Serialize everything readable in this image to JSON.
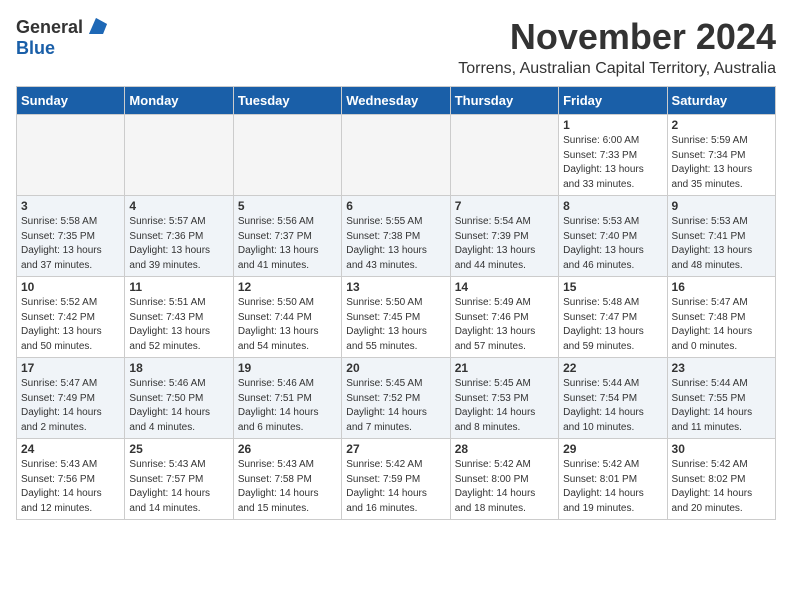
{
  "header": {
    "logo_general": "General",
    "logo_blue": "Blue",
    "month_year": "November 2024",
    "location": "Torrens, Australian Capital Territory, Australia"
  },
  "calendar": {
    "days_of_week": [
      "Sunday",
      "Monday",
      "Tuesday",
      "Wednesday",
      "Thursday",
      "Friday",
      "Saturday"
    ],
    "weeks": [
      [
        {
          "day": "",
          "info": ""
        },
        {
          "day": "",
          "info": ""
        },
        {
          "day": "",
          "info": ""
        },
        {
          "day": "",
          "info": ""
        },
        {
          "day": "",
          "info": ""
        },
        {
          "day": "1",
          "info": "Sunrise: 6:00 AM\nSunset: 7:33 PM\nDaylight: 13 hours\nand 33 minutes."
        },
        {
          "day": "2",
          "info": "Sunrise: 5:59 AM\nSunset: 7:34 PM\nDaylight: 13 hours\nand 35 minutes."
        }
      ],
      [
        {
          "day": "3",
          "info": "Sunrise: 5:58 AM\nSunset: 7:35 PM\nDaylight: 13 hours\nand 37 minutes."
        },
        {
          "day": "4",
          "info": "Sunrise: 5:57 AM\nSunset: 7:36 PM\nDaylight: 13 hours\nand 39 minutes."
        },
        {
          "day": "5",
          "info": "Sunrise: 5:56 AM\nSunset: 7:37 PM\nDaylight: 13 hours\nand 41 minutes."
        },
        {
          "day": "6",
          "info": "Sunrise: 5:55 AM\nSunset: 7:38 PM\nDaylight: 13 hours\nand 43 minutes."
        },
        {
          "day": "7",
          "info": "Sunrise: 5:54 AM\nSunset: 7:39 PM\nDaylight: 13 hours\nand 44 minutes."
        },
        {
          "day": "8",
          "info": "Sunrise: 5:53 AM\nSunset: 7:40 PM\nDaylight: 13 hours\nand 46 minutes."
        },
        {
          "day": "9",
          "info": "Sunrise: 5:53 AM\nSunset: 7:41 PM\nDaylight: 13 hours\nand 48 minutes."
        }
      ],
      [
        {
          "day": "10",
          "info": "Sunrise: 5:52 AM\nSunset: 7:42 PM\nDaylight: 13 hours\nand 50 minutes."
        },
        {
          "day": "11",
          "info": "Sunrise: 5:51 AM\nSunset: 7:43 PM\nDaylight: 13 hours\nand 52 minutes."
        },
        {
          "day": "12",
          "info": "Sunrise: 5:50 AM\nSunset: 7:44 PM\nDaylight: 13 hours\nand 54 minutes."
        },
        {
          "day": "13",
          "info": "Sunrise: 5:50 AM\nSunset: 7:45 PM\nDaylight: 13 hours\nand 55 minutes."
        },
        {
          "day": "14",
          "info": "Sunrise: 5:49 AM\nSunset: 7:46 PM\nDaylight: 13 hours\nand 57 minutes."
        },
        {
          "day": "15",
          "info": "Sunrise: 5:48 AM\nSunset: 7:47 PM\nDaylight: 13 hours\nand 59 minutes."
        },
        {
          "day": "16",
          "info": "Sunrise: 5:47 AM\nSunset: 7:48 PM\nDaylight: 14 hours\nand 0 minutes."
        }
      ],
      [
        {
          "day": "17",
          "info": "Sunrise: 5:47 AM\nSunset: 7:49 PM\nDaylight: 14 hours\nand 2 minutes."
        },
        {
          "day": "18",
          "info": "Sunrise: 5:46 AM\nSunset: 7:50 PM\nDaylight: 14 hours\nand 4 minutes."
        },
        {
          "day": "19",
          "info": "Sunrise: 5:46 AM\nSunset: 7:51 PM\nDaylight: 14 hours\nand 6 minutes."
        },
        {
          "day": "20",
          "info": "Sunrise: 5:45 AM\nSunset: 7:52 PM\nDaylight: 14 hours\nand 7 minutes."
        },
        {
          "day": "21",
          "info": "Sunrise: 5:45 AM\nSunset: 7:53 PM\nDaylight: 14 hours\nand 8 minutes."
        },
        {
          "day": "22",
          "info": "Sunrise: 5:44 AM\nSunset: 7:54 PM\nDaylight: 14 hours\nand 10 minutes."
        },
        {
          "day": "23",
          "info": "Sunrise: 5:44 AM\nSunset: 7:55 PM\nDaylight: 14 hours\nand 11 minutes."
        }
      ],
      [
        {
          "day": "24",
          "info": "Sunrise: 5:43 AM\nSunset: 7:56 PM\nDaylight: 14 hours\nand 12 minutes."
        },
        {
          "day": "25",
          "info": "Sunrise: 5:43 AM\nSunset: 7:57 PM\nDaylight: 14 hours\nand 14 minutes."
        },
        {
          "day": "26",
          "info": "Sunrise: 5:43 AM\nSunset: 7:58 PM\nDaylight: 14 hours\nand 15 minutes."
        },
        {
          "day": "27",
          "info": "Sunrise: 5:42 AM\nSunset: 7:59 PM\nDaylight: 14 hours\nand 16 minutes."
        },
        {
          "day": "28",
          "info": "Sunrise: 5:42 AM\nSunset: 8:00 PM\nDaylight: 14 hours\nand 18 minutes."
        },
        {
          "day": "29",
          "info": "Sunrise: 5:42 AM\nSunset: 8:01 PM\nDaylight: 14 hours\nand 19 minutes."
        },
        {
          "day": "30",
          "info": "Sunrise: 5:42 AM\nSunset: 8:02 PM\nDaylight: 14 hours\nand 20 minutes."
        }
      ]
    ]
  }
}
